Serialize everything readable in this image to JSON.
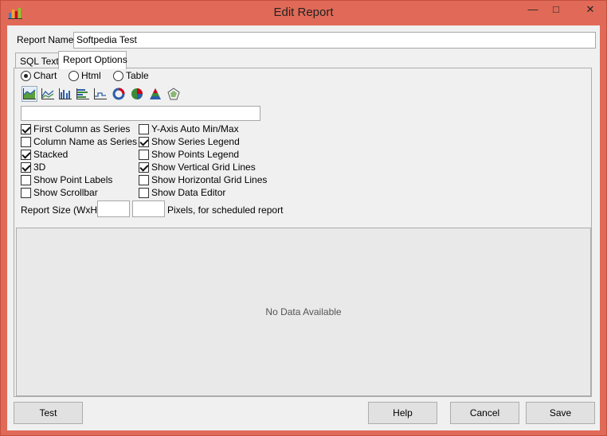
{
  "window": {
    "title": "Edit Report",
    "minimize_glyph": "—",
    "maximize_glyph": "□",
    "close_glyph": "✕"
  },
  "form": {
    "report_name_label": "Report Name:",
    "report_name_value": "Softpedia Test"
  },
  "tabs": [
    {
      "label": "SQL Text",
      "active": false
    },
    {
      "label": "Report Options",
      "active": true
    }
  ],
  "output_type": {
    "options": [
      {
        "label": "Chart",
        "selected": true
      },
      {
        "label": "Html",
        "selected": false
      },
      {
        "label": "Table",
        "selected": false
      }
    ]
  },
  "chart_types": [
    "area-chart-icon",
    "line-chart-icon",
    "bar-chart-icon",
    "horizontal-bar-chart-icon",
    "step-line-chart-icon",
    "donut-chart-icon",
    "pie-chart-icon",
    "pyramid-chart-icon",
    "radar-chart-icon"
  ],
  "chart_title_value": "",
  "options_left": [
    {
      "label": "First Column as Series",
      "checked": true
    },
    {
      "label": "Column Name as Series",
      "checked": false
    },
    {
      "label": "Stacked",
      "checked": true
    },
    {
      "label": "3D",
      "checked": true
    },
    {
      "label": "Show Point Labels",
      "checked": false
    },
    {
      "label": "Show Scrollbar",
      "checked": false
    }
  ],
  "options_right": [
    {
      "label": "Y-Axis Auto Min/Max",
      "checked": false
    },
    {
      "label": "Show Series Legend",
      "checked": true
    },
    {
      "label": "Show Points Legend",
      "checked": false
    },
    {
      "label": "Show Vertical Grid Lines",
      "checked": true
    },
    {
      "label": "Show Horizontal Grid Lines",
      "checked": false
    },
    {
      "label": "Show Data Editor",
      "checked": false
    }
  ],
  "report_size": {
    "label": "Report Size (WxH):",
    "width_value": "",
    "height_value": "",
    "suffix": "Pixels, for scheduled report"
  },
  "preview": {
    "empty_text": "No Data Available"
  },
  "buttons": {
    "test": "Test",
    "help": "Help",
    "cancel": "Cancel",
    "save": "Save"
  },
  "colors": {
    "title_bar": "#e06a57",
    "panel": "#f0f0f0"
  }
}
